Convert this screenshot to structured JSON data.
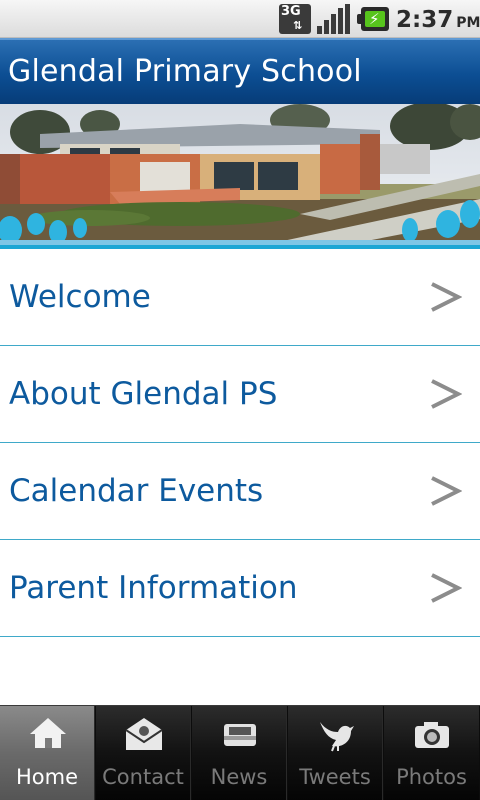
{
  "status_bar": {
    "network": "3G",
    "time": "2:37",
    "ampm": "PM",
    "battery_color": "#57c41c"
  },
  "header": {
    "title": "Glendal Primary School"
  },
  "menu": {
    "items": [
      {
        "label": "Welcome",
        "icon": "chevron-right-icon"
      },
      {
        "label": "About Glendal PS",
        "icon": "chevron-right-icon"
      },
      {
        "label": "Calendar Events",
        "icon": "chevron-right-icon"
      },
      {
        "label": "Parent Information",
        "icon": "chevron-right-icon"
      }
    ]
  },
  "tabs": [
    {
      "label": "Home",
      "icon": "home-icon",
      "active": true
    },
    {
      "label": "Contact",
      "icon": "envelope-icon",
      "active": false
    },
    {
      "label": "News",
      "icon": "news-tray-icon",
      "active": false
    },
    {
      "label": "Tweets",
      "icon": "bird-icon",
      "active": false
    },
    {
      "label": "Photos",
      "icon": "camera-icon",
      "active": false
    }
  ],
  "colors": {
    "header": "#0c4e93",
    "menu_text": "#0d5a9e",
    "divider": "#3fa9c9",
    "tabbar": "#0c0c0c"
  }
}
